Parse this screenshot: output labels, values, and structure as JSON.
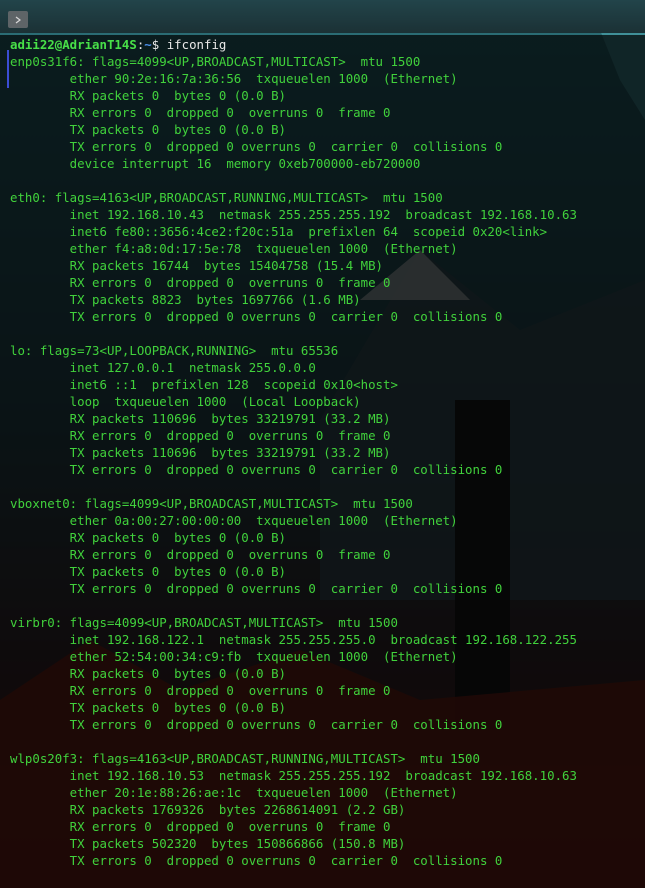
{
  "prompt": {
    "user_host": "adii22@AdrianT14S",
    "colon": ":",
    "path": "~",
    "dollar": "$ ",
    "command": "ifconfig"
  },
  "output_lines": [
    "enp0s31f6: flags=4099<UP,BROADCAST,MULTICAST>  mtu 1500",
    "        ether 90:2e:16:7a:36:56  txqueuelen 1000  (Ethernet)",
    "        RX packets 0  bytes 0 (0.0 B)",
    "        RX errors 0  dropped 0  overruns 0  frame 0",
    "        TX packets 0  bytes 0 (0.0 B)",
    "        TX errors 0  dropped 0 overruns 0  carrier 0  collisions 0",
    "        device interrupt 16  memory 0xeb700000-eb720000",
    "",
    "eth0: flags=4163<UP,BROADCAST,RUNNING,MULTICAST>  mtu 1500",
    "        inet 192.168.10.43  netmask 255.255.255.192  broadcast 192.168.10.63",
    "        inet6 fe80::3656:4ce2:f20c:51a  prefixlen 64  scopeid 0x20<link>",
    "        ether f4:a8:0d:17:5e:78  txqueuelen 1000  (Ethernet)",
    "        RX packets 16744  bytes 15404758 (15.4 MB)",
    "        RX errors 0  dropped 0  overruns 0  frame 0",
    "        TX packets 8823  bytes 1697766 (1.6 MB)",
    "        TX errors 0  dropped 0 overruns 0  carrier 0  collisions 0",
    "",
    "lo: flags=73<UP,LOOPBACK,RUNNING>  mtu 65536",
    "        inet 127.0.0.1  netmask 255.0.0.0",
    "        inet6 ::1  prefixlen 128  scopeid 0x10<host>",
    "        loop  txqueuelen 1000  (Local Loopback)",
    "        RX packets 110696  bytes 33219791 (33.2 MB)",
    "        RX errors 0  dropped 0  overruns 0  frame 0",
    "        TX packets 110696  bytes 33219791 (33.2 MB)",
    "        TX errors 0  dropped 0 overruns 0  carrier 0  collisions 0",
    "",
    "vboxnet0: flags=4099<UP,BROADCAST,MULTICAST>  mtu 1500",
    "        ether 0a:00:27:00:00:00  txqueuelen 1000  (Ethernet)",
    "        RX packets 0  bytes 0 (0.0 B)",
    "        RX errors 0  dropped 0  overruns 0  frame 0",
    "        TX packets 0  bytes 0 (0.0 B)",
    "        TX errors 0  dropped 0 overruns 0  carrier 0  collisions 0",
    "",
    "virbr0: flags=4099<UP,BROADCAST,MULTICAST>  mtu 1500",
    "        inet 192.168.122.1  netmask 255.255.255.0  broadcast 192.168.122.255",
    "        ether 52:54:00:34:c9:fb  txqueuelen 1000  (Ethernet)",
    "        RX packets 0  bytes 0 (0.0 B)",
    "        RX errors 0  dropped 0  overruns 0  frame 0",
    "        TX packets 0  bytes 0 (0.0 B)",
    "        TX errors 0  dropped 0 overruns 0  carrier 0  collisions 0",
    "",
    "wlp0s20f3: flags=4163<UP,BROADCAST,RUNNING,MULTICAST>  mtu 1500",
    "        inet 192.168.10.53  netmask 255.255.255.192  broadcast 192.168.10.63",
    "        ether 20:1e:88:26:ae:1c  txqueuelen 1000  (Ethernet)",
    "        RX packets 1769326  bytes 2268614091 (2.2 GB)",
    "        RX errors 0  dropped 0  overruns 0  frame 0",
    "        TX packets 502320  bytes 150866866 (150.8 MB)",
    "        TX errors 0  dropped 0 overruns 0  carrier 0  collisions 0"
  ],
  "icons": {
    "tab_button": "chevron-right-icon"
  },
  "colors": {
    "output_text": "#41d23c",
    "prompt_user": "#48e048",
    "prompt_path": "#4a8ee8",
    "command_text": "#e8e8e8",
    "terminal_background": "#000000",
    "accent_bar": "#3b4dd4"
  }
}
